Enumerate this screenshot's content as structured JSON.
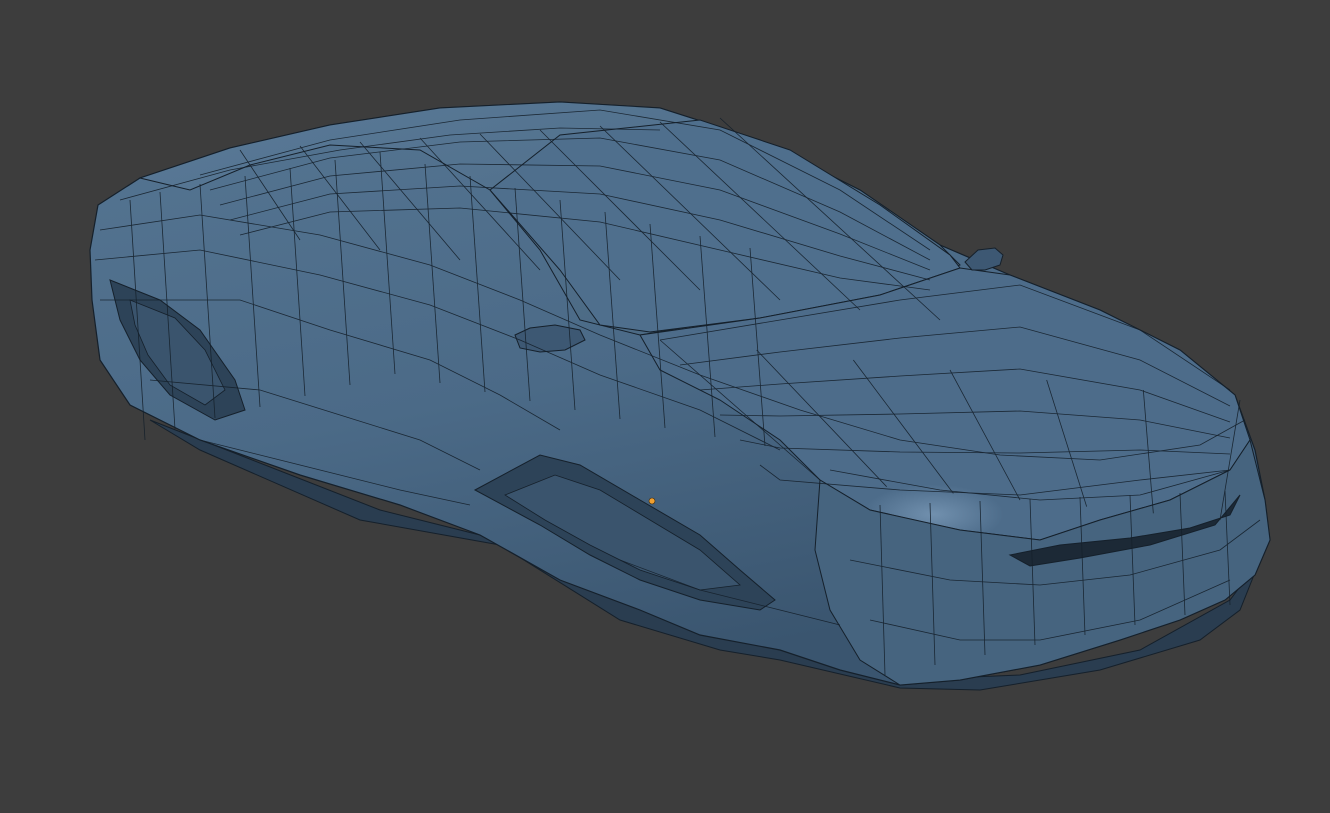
{
  "viewport": {
    "background_color": "#3d3d3d",
    "mode": "edit-mode-wireframe-overlay"
  },
  "model": {
    "kind": "car-body-mesh",
    "base_color": "#4b6a87",
    "shadow_color": "#314a61",
    "highlight_color": "#6f8fae",
    "wire_color": "#15202b"
  },
  "origin": {
    "color": "#f0a030"
  }
}
